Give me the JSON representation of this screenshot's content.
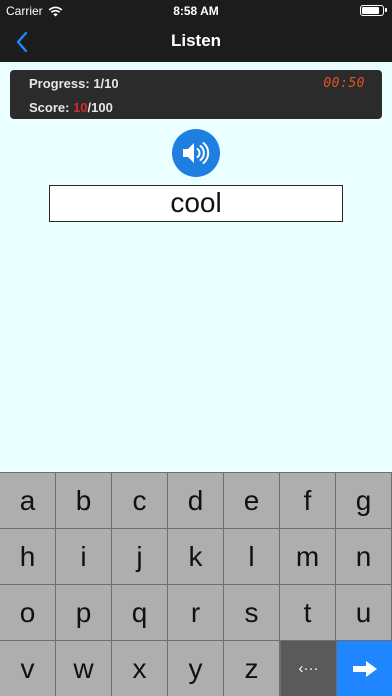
{
  "status": {
    "carrier": "Carrier",
    "time": "8:58 AM"
  },
  "nav": {
    "title": "Listen",
    "back_icon": "chevron-left-icon"
  },
  "panel": {
    "progress_label": "Progress: ",
    "progress_value": "1/10",
    "score_label": "Score: ",
    "score_value": "10",
    "score_total": "/100",
    "timer": "00:50"
  },
  "answer": {
    "text": "cool"
  },
  "keyboard": {
    "rows": [
      [
        "a",
        "b",
        "c",
        "d",
        "e",
        "f",
        "g"
      ],
      [
        "h",
        "i",
        "j",
        "k",
        "l",
        "m",
        "n"
      ],
      [
        "o",
        "p",
        "q",
        "r",
        "s",
        "t",
        "u"
      ],
      [
        "v",
        "w",
        "x",
        "y",
        "z"
      ]
    ],
    "backspace_glyph": "‹···",
    "enter_icon": "arrow-right-icon"
  },
  "colors": {
    "accent": "#1e7fe0",
    "score": "#d32a2a",
    "timer": "#e0542a",
    "background": "#eaffff"
  }
}
